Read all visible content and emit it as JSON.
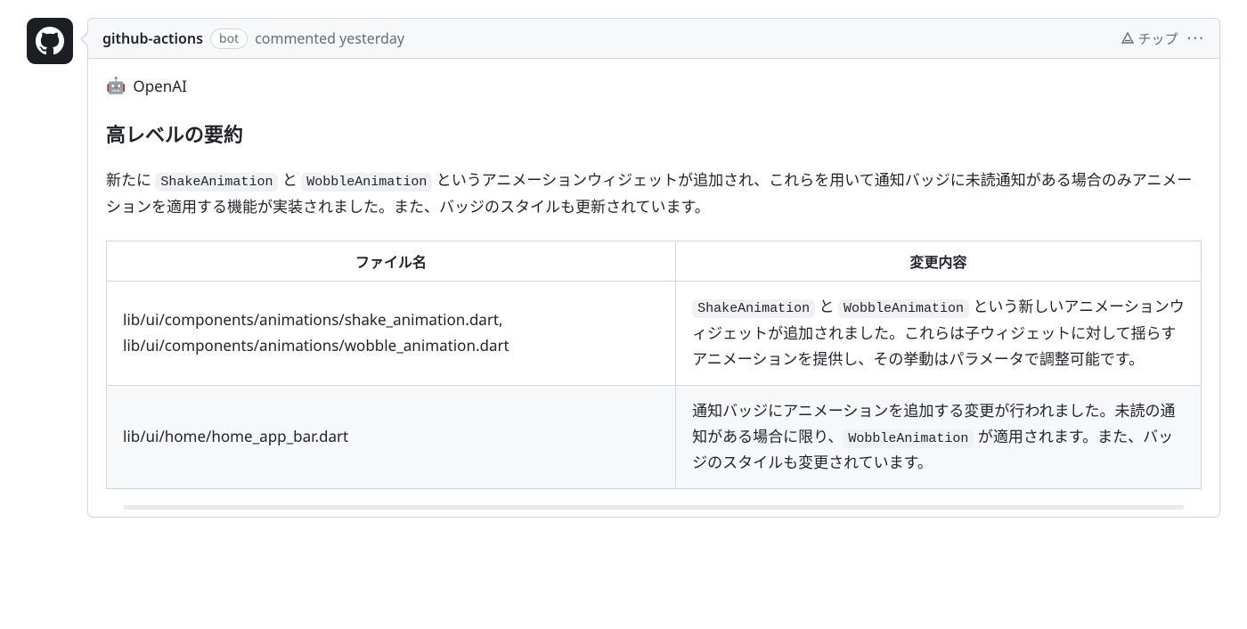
{
  "header": {
    "author": "github-actions",
    "bot_label": "bot",
    "timestamp": "commented yesterday",
    "tip_label": "チップ"
  },
  "body": {
    "intro_emoji": "🤖",
    "intro_text": "OpenAI",
    "heading": "高レベルの要約",
    "paragraph": {
      "pre1": "新たに ",
      "code1": "ShakeAnimation",
      "mid1": " と ",
      "code2": "WobbleAnimation",
      "post": " というアニメーションウィジェットが追加され、これらを用いて通知バッジに未読通知がある場合のみアニメーションを適用する機能が実装されました。また、バッジのスタイルも更新されています。"
    }
  },
  "table": {
    "headers": {
      "file": "ファイル名",
      "desc": "変更内容"
    },
    "rows": [
      {
        "file": "lib/ui/components/animations/shake_animation.dart, lib/ui/components/animations/wobble_animation.dart",
        "desc": {
          "code1": "ShakeAnimation",
          "mid": " と ",
          "code2": "WobbleAnimation",
          "post": " という新しいアニメーションウィジェットが追加されました。これらは子ウィジェットに対して揺らすアニメーションを提供し、その挙動はパラメータで調整可能です。"
        }
      },
      {
        "file": "lib/ui/home/home_app_bar.dart",
        "desc": {
          "pre": "通知バッジにアニメーションを追加する変更が行われました。未読の通知がある場合に限り、",
          "code1": "WobbleAnimation",
          "post": " が適用されます。また、バッジのスタイルも変更されています。"
        }
      }
    ]
  }
}
